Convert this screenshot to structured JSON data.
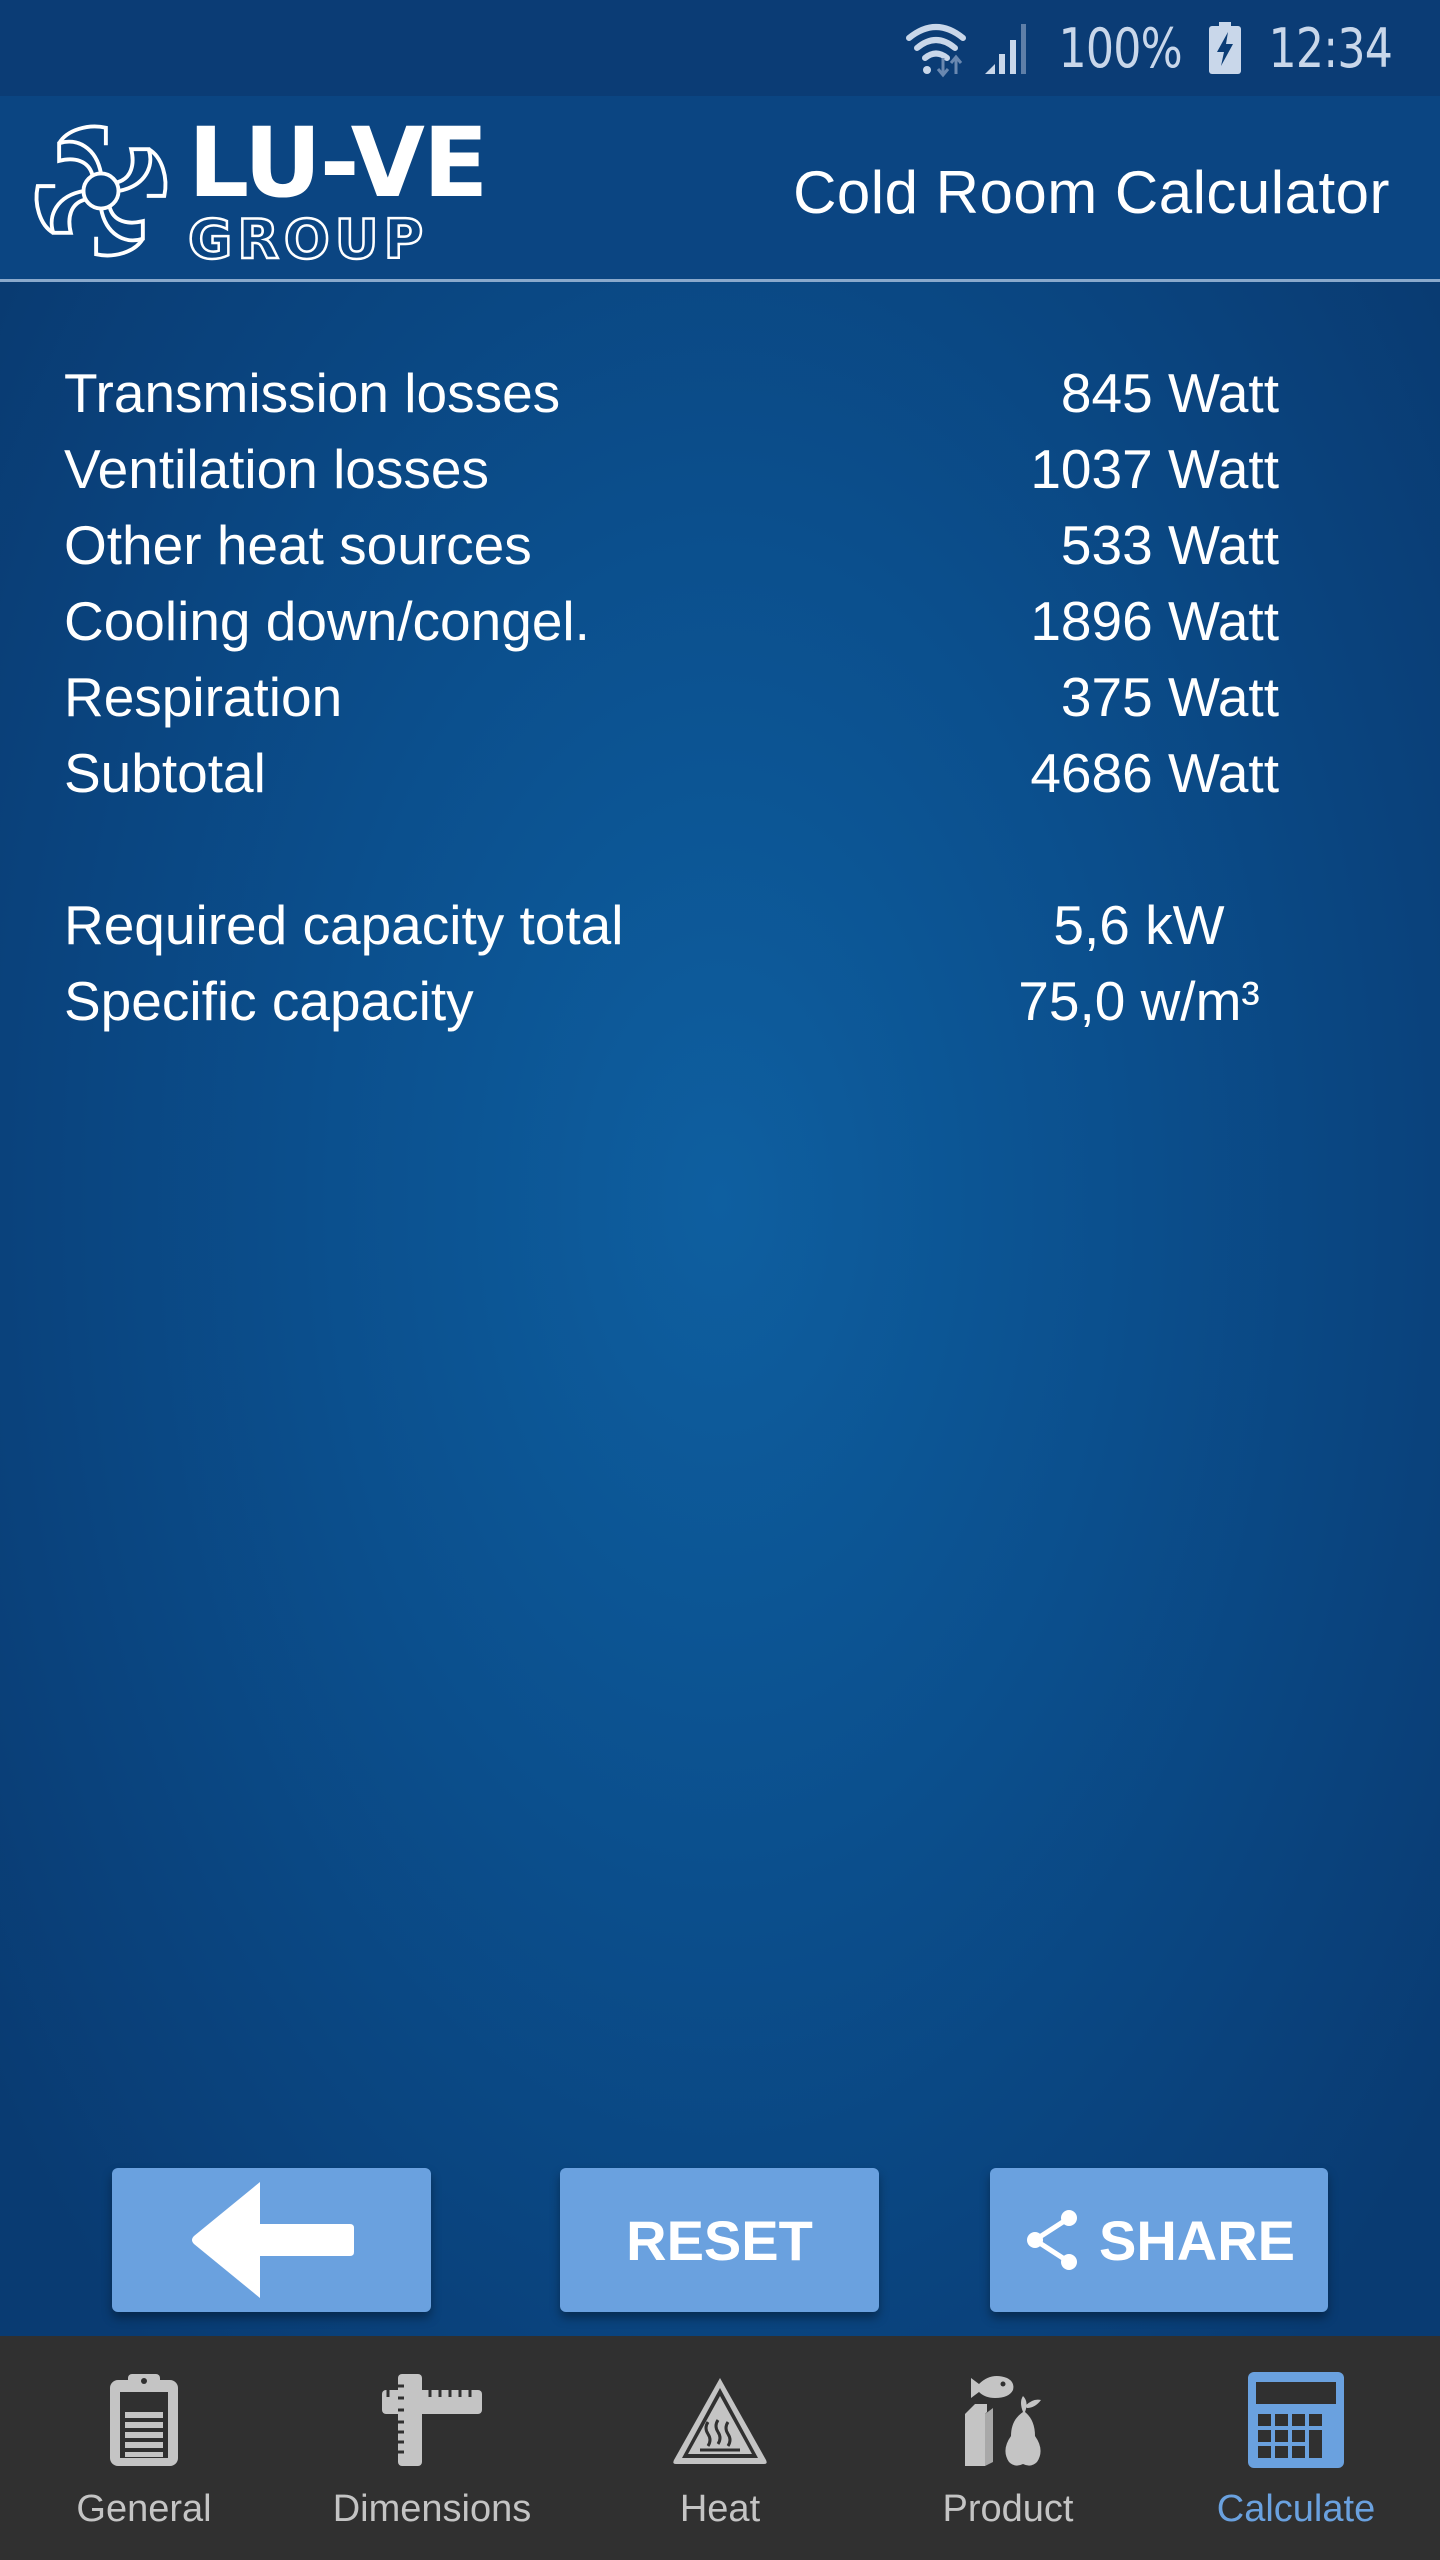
{
  "status_bar": {
    "battery_percent": "100%",
    "time": "12:34",
    "icons": [
      "wifi-icon",
      "signal-icon",
      "battery-charging-icon"
    ]
  },
  "header": {
    "logo_main": "LU-VE",
    "logo_sub": "GROUP",
    "title": "Cold Room Calculator"
  },
  "results": {
    "losses": [
      {
        "label": "Transmission losses",
        "value": "845 Watt"
      },
      {
        "label": "Ventilation losses",
        "value": "1037 Watt"
      },
      {
        "label": "Other heat sources",
        "value": "533 Watt"
      },
      {
        "label": "Cooling down/congel.",
        "value": "1896 Watt"
      },
      {
        "label": "Respiration",
        "value": "375 Watt"
      },
      {
        "label": "Subtotal",
        "value": "4686 Watt"
      }
    ],
    "totals": [
      {
        "label": "Required capacity total",
        "value": "5,6 kW"
      },
      {
        "label": "Specific capacity",
        "value": "75,0 w/m³"
      }
    ]
  },
  "actions": {
    "back_icon": "arrow-left-icon",
    "reset_label": "RESET",
    "share_label": "SHARE",
    "share_icon": "share-icon"
  },
  "nav": {
    "items": [
      {
        "label": "General",
        "icon": "clipboard-icon",
        "active": false
      },
      {
        "label": "Dimensions",
        "icon": "ruler-icon",
        "active": false
      },
      {
        "label": "Heat",
        "icon": "heat-warning-icon",
        "active": false
      },
      {
        "label": "Product",
        "icon": "food-products-icon",
        "active": false
      },
      {
        "label": "Calculate",
        "icon": "calculator-icon",
        "active": true
      }
    ]
  },
  "colors": {
    "accent": "#6aa1df",
    "header_bg": "#0b4582",
    "nav_bg": "#303030",
    "nav_inactive": "#c4c4c4"
  }
}
